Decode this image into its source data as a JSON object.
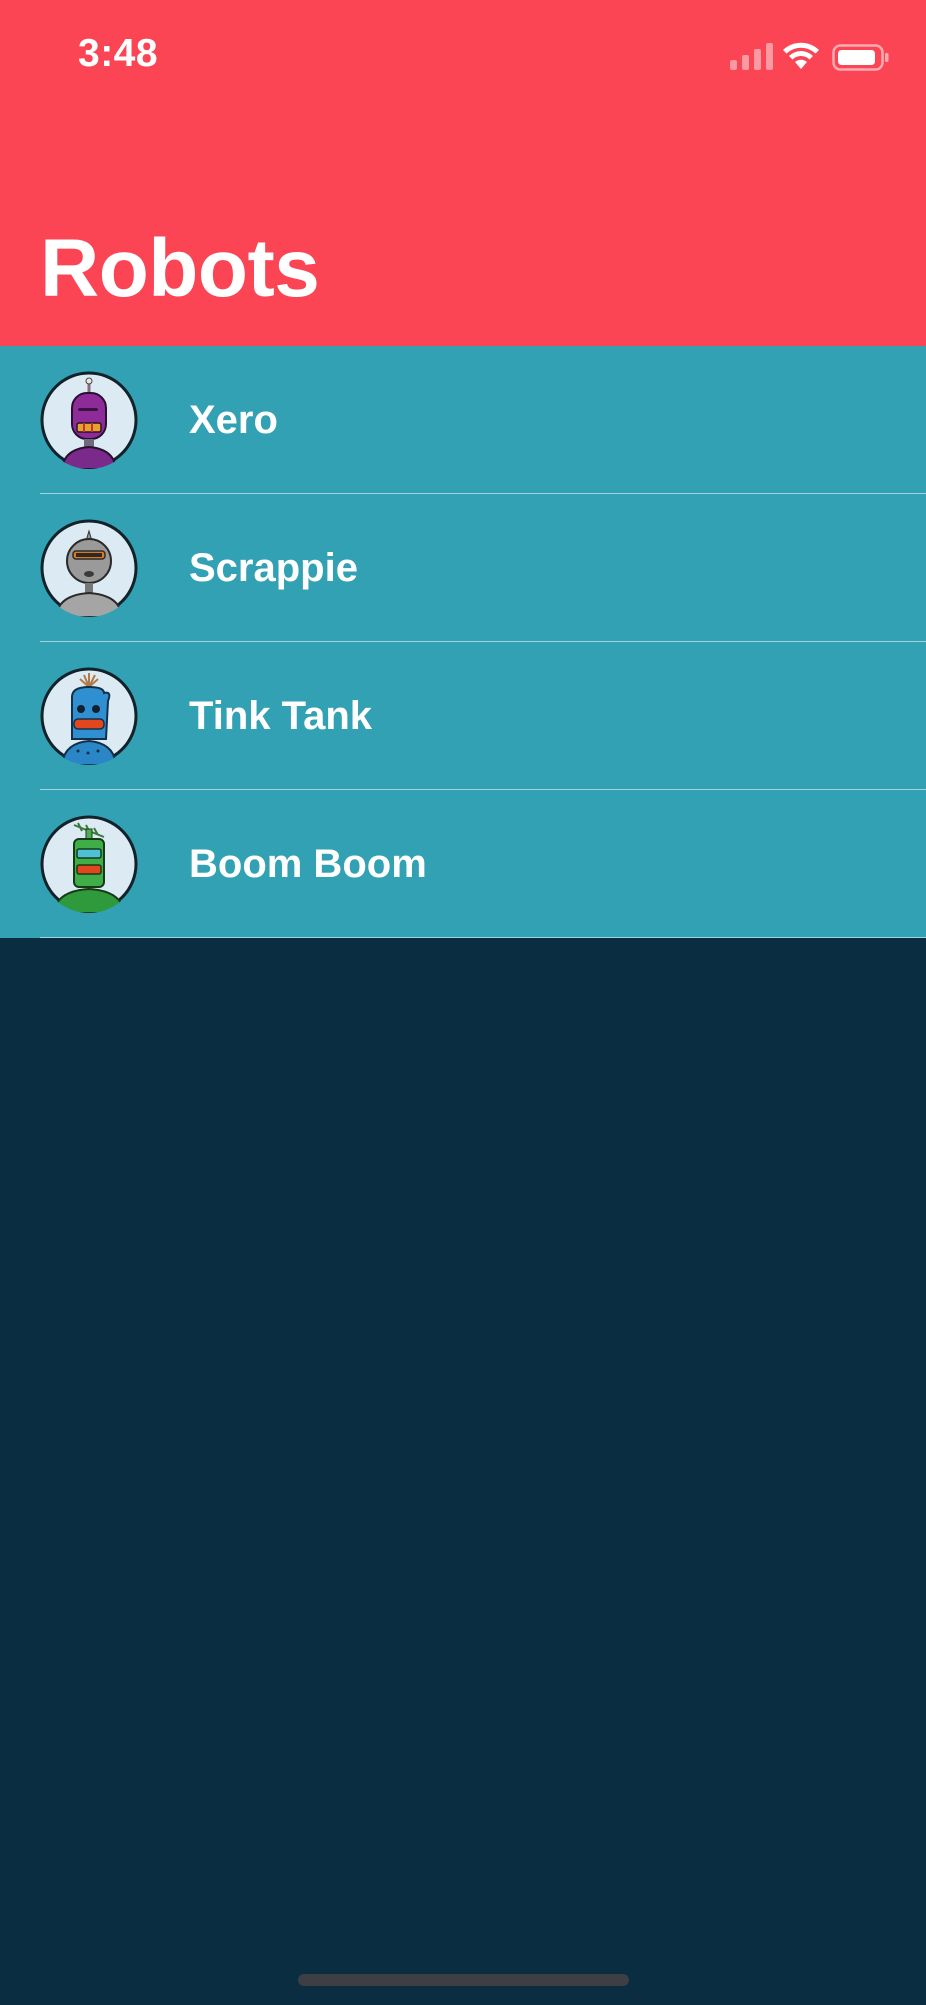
{
  "status_bar": {
    "time": "3:48",
    "signal_icon": "cellular-signal-icon",
    "wifi_icon": "wifi-icon",
    "battery_icon": "battery-icon"
  },
  "header": {
    "title": "Robots",
    "background_color": "#fb4554"
  },
  "list": {
    "background_color": "#32a1b3",
    "items": [
      {
        "name": "Xero",
        "avatar": "purple-robot-avatar"
      },
      {
        "name": "Scrappie",
        "avatar": "gray-robot-avatar"
      },
      {
        "name": "Tink Tank",
        "avatar": "blue-robot-avatar"
      },
      {
        "name": "Boom Boom",
        "avatar": "green-robot-avatar"
      }
    ]
  },
  "page": {
    "background_color": "#0a2d41"
  }
}
